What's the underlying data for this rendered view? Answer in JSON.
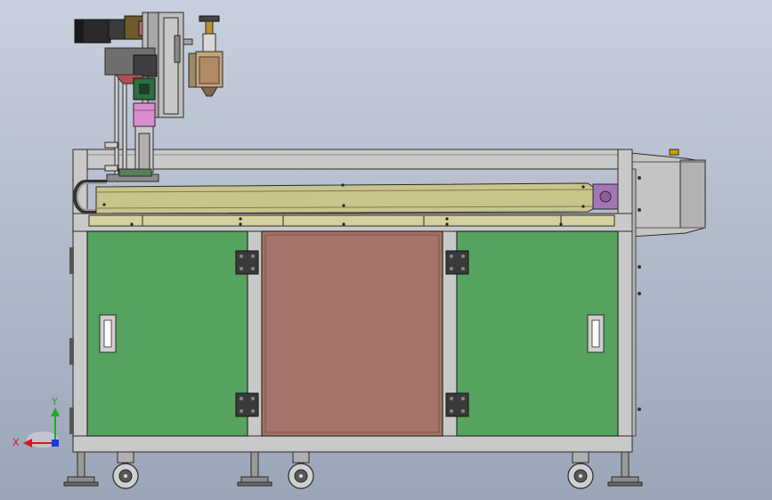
{
  "viewport": {
    "title": "",
    "background_gradient": [
      "#c9d0dd",
      "#9aa6b8"
    ]
  },
  "machine": {
    "description_colors": {
      "frame": "#c7c7c7",
      "frame_edge": "#2b2b2b",
      "left_door": "#55a35e",
      "right_door": "#55a35e",
      "center_panel": "#a47369",
      "conveyor_belt": "#c9c48a",
      "motor_pink": "#d98fcf",
      "hinge": "#3a3a3a",
      "caster": "#5a5a5a"
    },
    "parts": [
      "frame",
      "conveyor",
      "gantry-head",
      "servo-motor",
      "left-door",
      "center-panel",
      "right-door",
      "side-enclosure",
      "casters",
      "leveling-feet"
    ]
  },
  "triad": {
    "x_label": "X",
    "y_label": "Y",
    "x_color": "#d11b1b",
    "y_color": "#1faa2c",
    "z_color": "#2236d8"
  }
}
